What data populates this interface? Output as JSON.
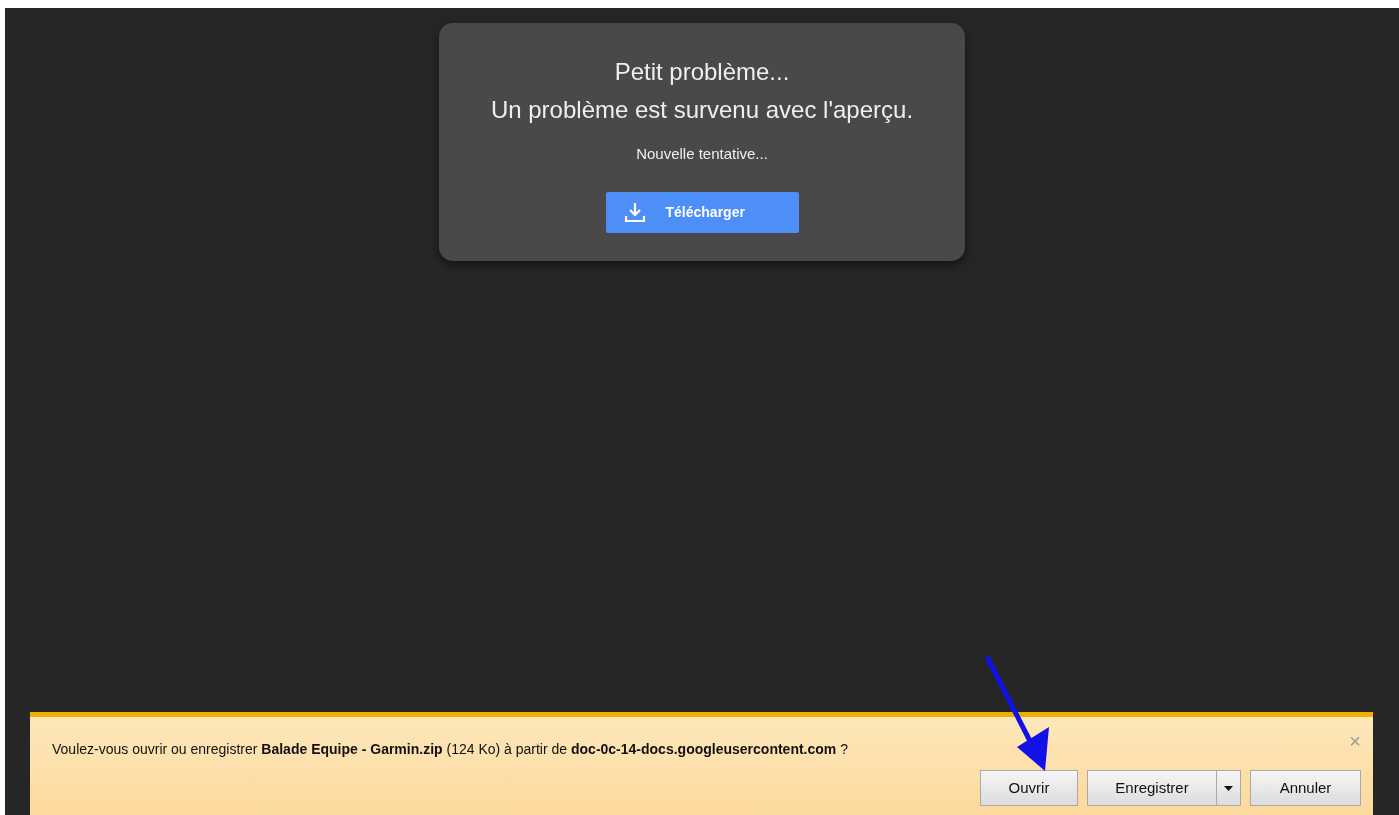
{
  "preview_error": {
    "title": "Petit problème...",
    "message": "Un problème est survenu avec l'aperçu.",
    "status": "Nouvelle tentative...",
    "download_button": "Télécharger"
  },
  "download_bar": {
    "prompt": "Voulez-vous ouvrir ou enregistrer **Balade Equipe - Garmin.zip** (124 Ko) à partir de **doc-0c-14-docs.googleusercontent.com** ?",
    "close": "×",
    "buttons": [
      {
        "label": "Ouvrir",
        "kind": "plain"
      },
      {
        "label": "Enregistrer",
        "kind": "split"
      },
      {
        "label": "Annuler",
        "kind": "plain"
      }
    ]
  }
}
